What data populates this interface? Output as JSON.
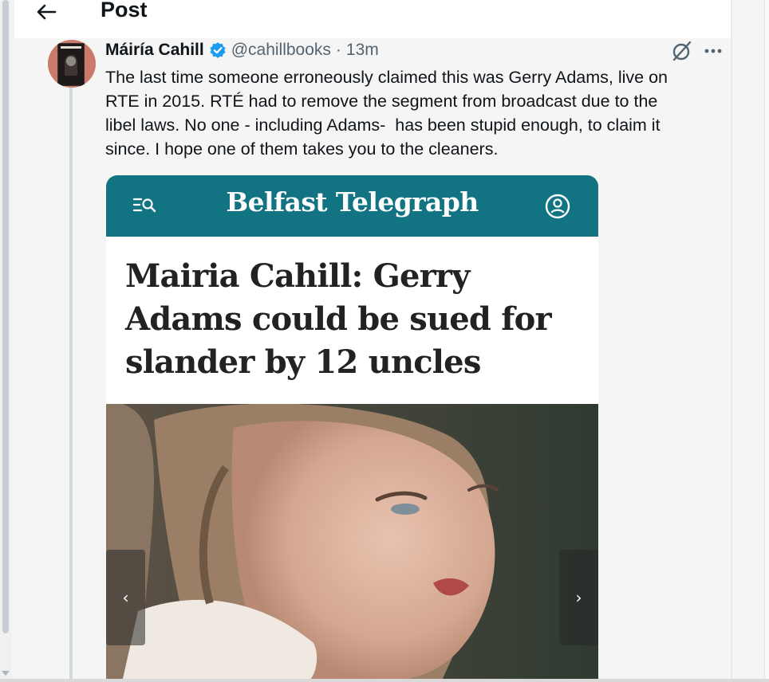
{
  "header": {
    "title": "Post",
    "back_icon": "arrow-left-icon"
  },
  "tweet": {
    "author_name": "Máiría Cahill",
    "handle": "@cahillbooks",
    "separator": "·",
    "time": "13m",
    "text": "The last time someone erroneously claimed this was Gerry Adams, live on\nRTE in 2015. RTÉ had to remove the segment from broadcast due to the\nlibel laws. No one - including Adams-  has been stupid enough, to claim it\nsince. I hope one of them takes you to the cleaners.",
    "icons": [
      "verified-badge-icon",
      "grok-icon",
      "more-icon"
    ]
  },
  "card": {
    "publication": "Belfast Telegraph",
    "headline": "Mairia Cahill: Gerry Adams could be sued for slander by 12 uncles",
    "prev_label": "‹",
    "next_label": "›",
    "brand_color": "#127483"
  },
  "colors": {
    "verified": "#1d9bf0",
    "muted_text": "#536471"
  }
}
